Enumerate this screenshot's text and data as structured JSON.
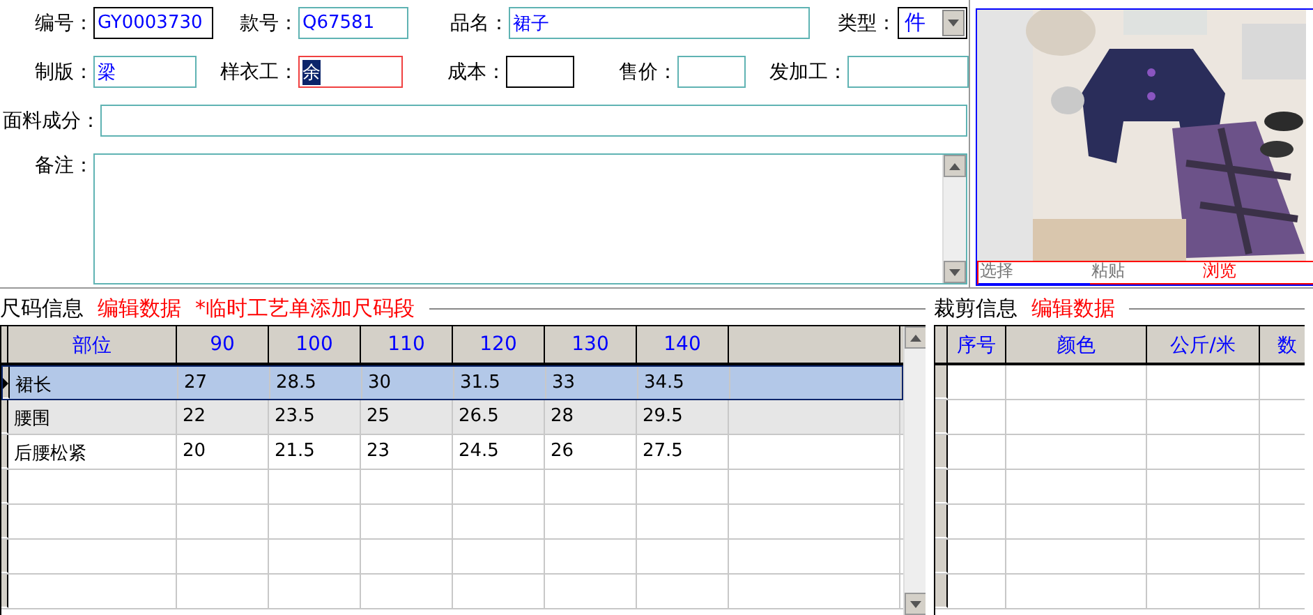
{
  "form": {
    "row1": [
      {
        "label": "编号：",
        "value": "GY0003730",
        "kind": "text"
      },
      {
        "label": "款号：",
        "value": "Q67581",
        "kind": "text"
      },
      {
        "label": "品名：",
        "value": "裙子",
        "kind": "text"
      },
      {
        "label": "类型：",
        "value": "件",
        "kind": "select"
      }
    ],
    "row2": [
      {
        "label": "制版：",
        "value": "梁",
        "kind": "text"
      },
      {
        "label": "样衣工：",
        "value": "余",
        "kind": "text",
        "focused": true
      },
      {
        "label": "成本：",
        "kind": "text"
      },
      {
        "label": "售价：",
        "kind": "text"
      },
      {
        "label": "发加工：",
        "kind": "text"
      }
    ],
    "fabric": {
      "label": "面料成分："
    },
    "notes": {
      "label": "备注："
    }
  },
  "picture_panel": {
    "buttons": [
      {
        "label": "选择",
        "selected": true
      },
      {
        "label": "粘贴",
        "selected": false
      },
      {
        "label": "浏览",
        "selected": false
      }
    ]
  },
  "size_panel": {
    "title": "尺码信息",
    "links": [
      "编辑数据",
      "*临时工艺单添加尺码段"
    ],
    "columns": [
      "部位",
      "90",
      "100",
      "110",
      "120",
      "130",
      "140"
    ],
    "rows": [
      {
        "cells": [
          "裙长",
          "27",
          "28.5",
          "30",
          "31.5",
          "33",
          "34.5"
        ],
        "selected": true
      },
      {
        "cells": [
          "腰围",
          "22",
          "23.5",
          "25",
          "26.5",
          "28",
          "29.5"
        ],
        "selected": false
      },
      {
        "cells": [
          "后腰松紧",
          "20",
          "21.5",
          "23",
          "24.5",
          "26",
          "27.5"
        ],
        "selected": false
      }
    ]
  },
  "cut_panel": {
    "title": "裁剪信息",
    "link": "编辑数据",
    "columns": [
      "序号",
      "颜色",
      "公斤/米",
      "数"
    ]
  }
}
